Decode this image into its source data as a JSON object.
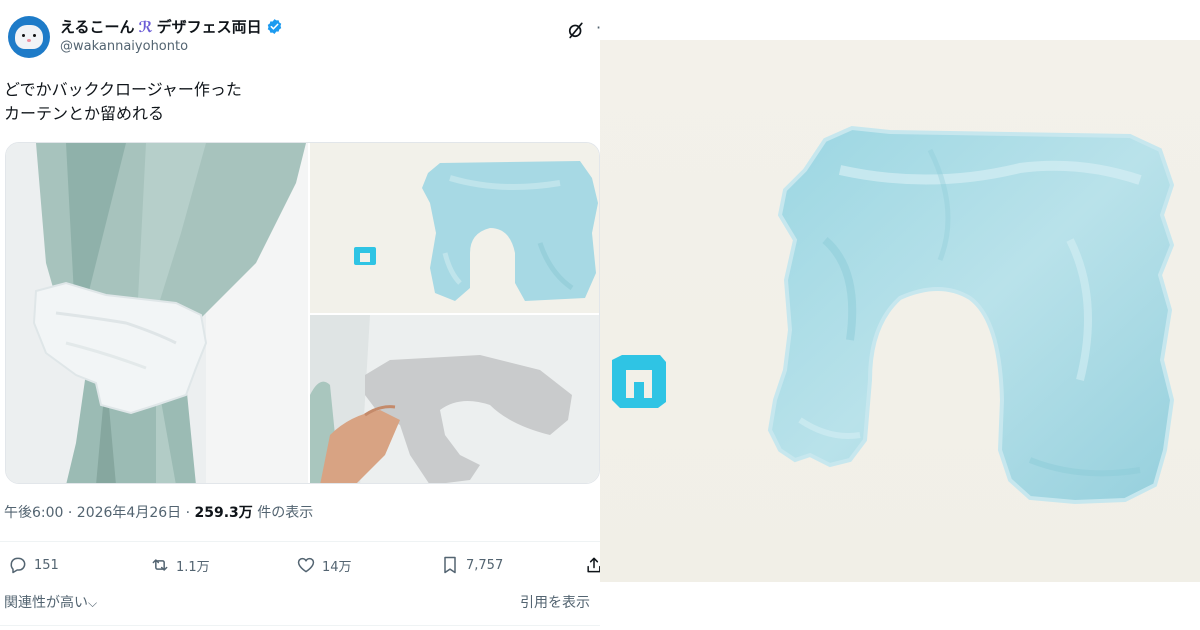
{
  "tweet": {
    "author": {
      "display_name": "えるこーん",
      "event_name": "デザフェス両日",
      "handle": "@wakannaiyohonto",
      "verified": true
    },
    "text_lines": [
      "どでかバッククロージャー作った",
      "カーテンとか留めれる"
    ],
    "meta": {
      "time_date": "午後6:00 · 2026年4月26日 · ",
      "views_count": "259.3万",
      "views_label": " 件の表示"
    },
    "actions": {
      "replies": "151",
      "reposts": "1.1万",
      "likes": "14万",
      "bookmarks": "7,757"
    },
    "footer": {
      "relevance": "関連性が高い",
      "quotes": "引用を表示"
    },
    "colors": {
      "accent": "#1d9bf0",
      "secondary_text": "#536471",
      "closure_blue": "#9fd4e0",
      "curtain": "#9cbdb7",
      "small_closure": "#2fc4e4"
    }
  }
}
